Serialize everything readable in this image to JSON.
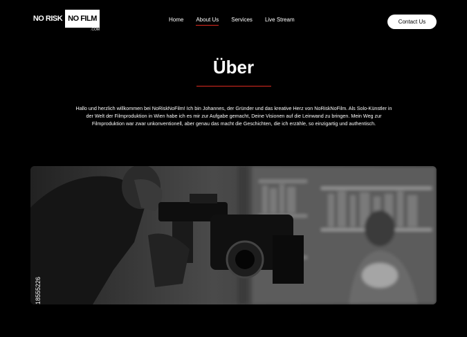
{
  "header": {
    "logo": {
      "left": "NO RISK",
      "right": "NO FILM",
      "sub": ".COM"
    },
    "nav": [
      {
        "label": "Home",
        "active": false
      },
      {
        "label": "About Us",
        "active": true
      },
      {
        "label": "Services",
        "active": false
      },
      {
        "label": "Live Stream",
        "active": false
      }
    ],
    "contact_label": "Contact Us"
  },
  "main": {
    "title": "Über",
    "intro": "Hallo und herzlich willkommen bei NoRiskNoFilm! Ich bin Johannes, der Gründer und das kreative Herz von NoRiskNoFilm. Als Solo-Künstler in der Welt der Filmproduktion in Wien habe ich es mir zur Aufgabe gemacht, Deine Visionen auf die Leinwand zu bringen. Mein Weg zur Filmproduktion war zwar unkonventionell, aber genau das macht die Geschichten, die ich erzähle, so einzigartig und authentisch.",
    "photo_stock_id": "18555226"
  },
  "colors": {
    "accent": "#e02b20",
    "background": "#000000"
  }
}
